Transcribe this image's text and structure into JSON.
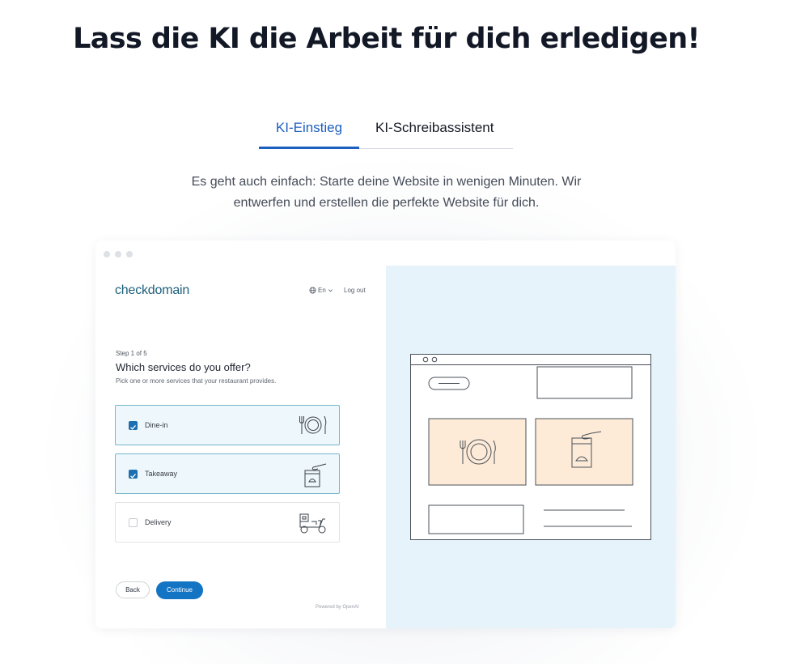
{
  "headline": "Lass die KI die Arbeit für dich erledigen!",
  "tabs": [
    {
      "label": "KI-Einstieg",
      "active": true
    },
    {
      "label": "KI-Schreibassistent",
      "active": false
    }
  ],
  "subtitle_lines": [
    "Es geht auch einfach: Starte deine Website in wenigen Minuten. Wir",
    "entwerfen und erstellen die perfekte Website für dich."
  ],
  "app": {
    "logo_text": "checkdomain",
    "language": "En",
    "logout_label": "Log out",
    "step": "Step 1 of 5",
    "question": "Which services do you offer?",
    "hint": "Pick one or more services that your restaurant provides.",
    "options": [
      {
        "label": "Dine-in",
        "checked": true,
        "icon": "cutlery-plate-icon"
      },
      {
        "label": "Takeaway",
        "checked": true,
        "icon": "takeaway-bag-icon"
      },
      {
        "label": "Delivery",
        "checked": false,
        "icon": "delivery-scooter-icon"
      }
    ],
    "back_label": "Back",
    "continue_label": "Continue",
    "powered_by": "Powered by OpenAI"
  },
  "colors": {
    "accent": "#1d5fbf",
    "brand": "#1b5f7a",
    "selected_border": "#74b6cc",
    "illustration_bg": "#e7f3fb",
    "illustration_card": "#fdebd8"
  }
}
